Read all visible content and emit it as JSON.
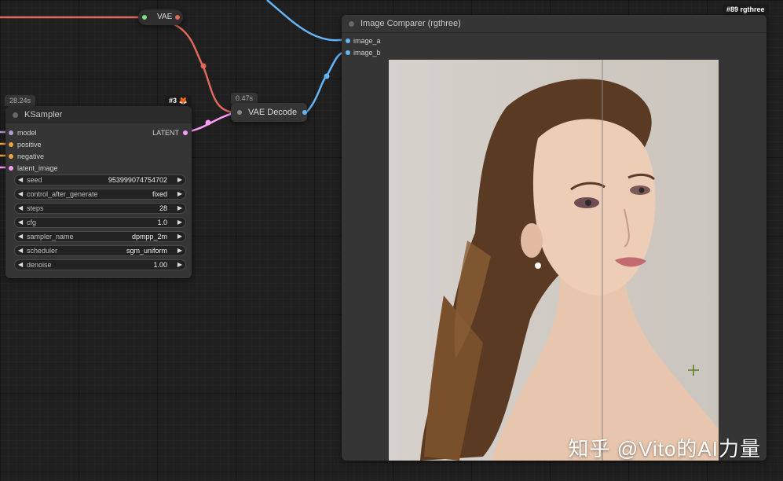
{
  "vae_node": {
    "title": "VAE",
    "color": "#e06a5a"
  },
  "ksampler": {
    "time": "28.24s",
    "id": "#3",
    "id_icon": "fox-icon",
    "title": "KSampler",
    "inputs": [
      {
        "label": "model",
        "color": "#b39ddb"
      },
      {
        "label": "positive",
        "color": "#f0a43c"
      },
      {
        "label": "negative",
        "color": "#f0a43c"
      },
      {
        "label": "latent_image",
        "color": "#ff9cf9"
      }
    ],
    "output": {
      "label": "LATENT",
      "color": "#ff9cf9"
    },
    "widgets": [
      {
        "label": "seed",
        "value": "953999074754702"
      },
      {
        "label": "control_after_generate",
        "value": "fixed"
      },
      {
        "label": "steps",
        "value": "28"
      },
      {
        "label": "cfg",
        "value": "1.0"
      },
      {
        "label": "sampler_name",
        "value": "dpmpp_2m"
      },
      {
        "label": "scheduler",
        "value": "sgm_uniform"
      },
      {
        "label": "denoise",
        "value": "1.00"
      }
    ]
  },
  "vae_decode": {
    "time": "0.47s",
    "title": "VAE Decode"
  },
  "comparer": {
    "badge": "#89 rgthree",
    "title": "Image Comparer (rgthree)",
    "inputs": [
      {
        "label": "image_a",
        "color": "#64b5f6"
      },
      {
        "label": "image_b",
        "color": "#64b5f6"
      }
    ]
  },
  "watermark": "知乎 @Vito的AI力量"
}
